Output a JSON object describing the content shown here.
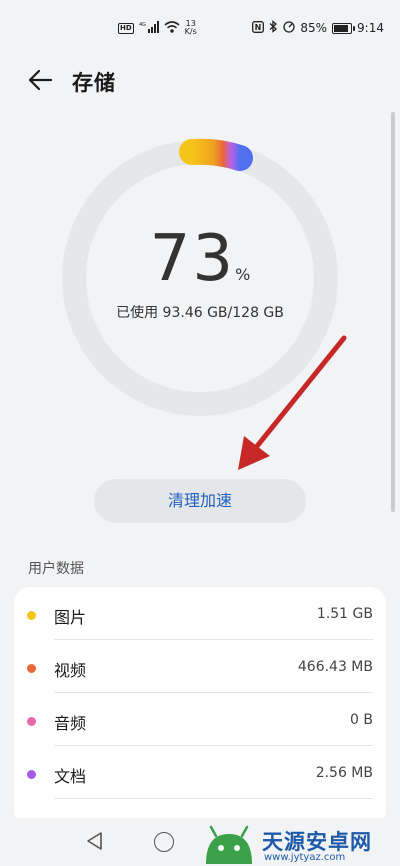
{
  "status_bar": {
    "hd": "HD",
    "network": "4G",
    "speed_value": "13",
    "speed_unit": "K/s",
    "nfc": "N",
    "battery_level": "85%",
    "time": "9:14"
  },
  "header": {
    "title": "存储"
  },
  "storage": {
    "percent": "73",
    "percent_sign": "%",
    "used_text": "已使用 93.46 GB/128 GB"
  },
  "actions": {
    "clean_label": "清理加速"
  },
  "section": {
    "user_data_label": "用户数据"
  },
  "items": [
    {
      "name": "图片",
      "size": "1.51 GB",
      "color": "#f5c518"
    },
    {
      "name": "视频",
      "size": "466.43 MB",
      "color": "#e8663a"
    },
    {
      "name": "音频",
      "size": "0 B",
      "color": "#e868a5"
    },
    {
      "name": "文档",
      "size": "2.56 MB",
      "color": "#a15be8"
    }
  ],
  "watermark": {
    "name": "天源安卓网",
    "url": "www.jytyaz.com"
  },
  "colors": {
    "accent": "#1f5fbf",
    "annotation_arrow": "#c62828"
  }
}
